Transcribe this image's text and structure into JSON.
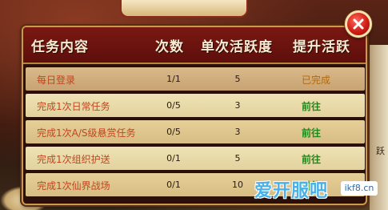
{
  "header": {
    "task": "任务内容",
    "count": "次数",
    "single": "单次活跃度",
    "promote": "提升活跃"
  },
  "rows": [
    {
      "task": "每日登录",
      "count": "1/1",
      "points": "5",
      "status": "已完成",
      "status_type": "done"
    },
    {
      "task": "完成1次日常任务",
      "count": "0/5",
      "points": "3",
      "status": "前往",
      "status_type": "go"
    },
    {
      "task": "完成1次A/S级悬赏任务",
      "count": "0/5",
      "points": "3",
      "status": "前往",
      "status_type": "go"
    },
    {
      "task": "完成1次组织护送",
      "count": "0/1",
      "points": "5",
      "status": "前往",
      "status_type": "go"
    },
    {
      "task": "完成1次仙界战场",
      "count": "0/1",
      "points": "10",
      "status": "前往",
      "status_type": "go"
    }
  ],
  "background": {
    "side_text": "跃"
  },
  "watermark": {
    "brand": "爱开服吧",
    "site": "ikf8.cn"
  },
  "colors": {
    "header_bg": "#6e1410",
    "done": "#b06a10",
    "go": "#1e8a1a",
    "task_text": "#c0461e"
  },
  "icons": {
    "close": "close-icon"
  }
}
